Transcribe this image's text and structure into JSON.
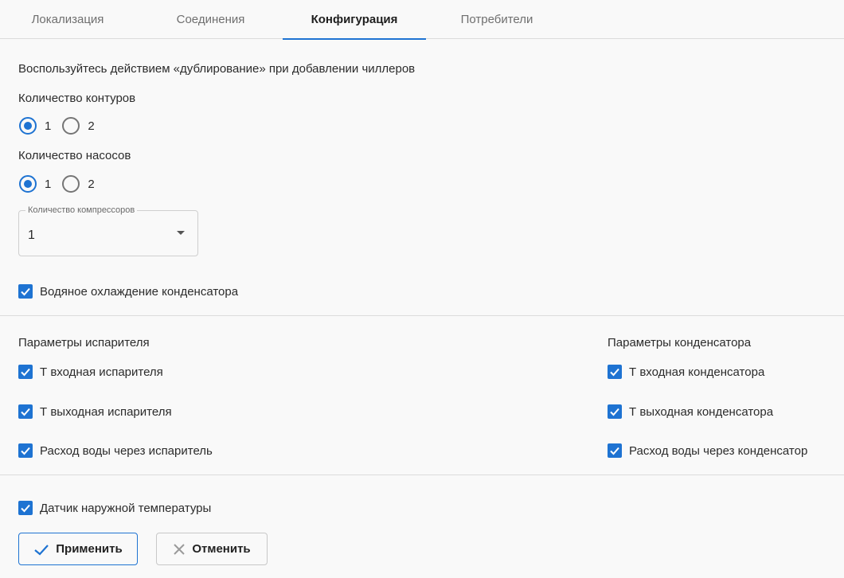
{
  "tabs": [
    {
      "label": "Локализация",
      "active": false
    },
    {
      "label": "Соединения",
      "active": false
    },
    {
      "label": "Конфигурация",
      "active": true
    },
    {
      "label": "Потребители",
      "active": false
    }
  ],
  "hint": "Воспользуйтесь действием «дублирование» при добавлении чиллеров",
  "circuits": {
    "label": "Количество контуров",
    "options": [
      "1",
      "2"
    ],
    "selected": "1"
  },
  "pumps": {
    "label": "Количество насосов",
    "options": [
      "1",
      "2"
    ],
    "selected": "1"
  },
  "compressors": {
    "label": "Количество компрессоров",
    "value": "1"
  },
  "water_cooling": {
    "label": "Водяное охлаждение конденсатора",
    "checked": true
  },
  "evaporator": {
    "title": "Параметры испарителя",
    "items": [
      {
        "label": "Т входная испарителя",
        "checked": true
      },
      {
        "label": "Т выходная испарителя",
        "checked": true
      },
      {
        "label": "Расход воды через испаритель",
        "checked": true
      }
    ]
  },
  "condenser": {
    "title": "Параметры конденсатора",
    "items": [
      {
        "label": "Т входная конденсатора",
        "checked": true
      },
      {
        "label": "Т выходная конденсатора",
        "checked": true
      },
      {
        "label": "Расход воды через конденсатор",
        "checked": true
      }
    ]
  },
  "outdoor_sensor": {
    "label": "Датчик наружной температуры",
    "checked": true
  },
  "actions": {
    "apply": "Применить",
    "cancel": "Отменить"
  },
  "colors": {
    "accent": "#1e73d2",
    "background": "#f9f9f9"
  }
}
